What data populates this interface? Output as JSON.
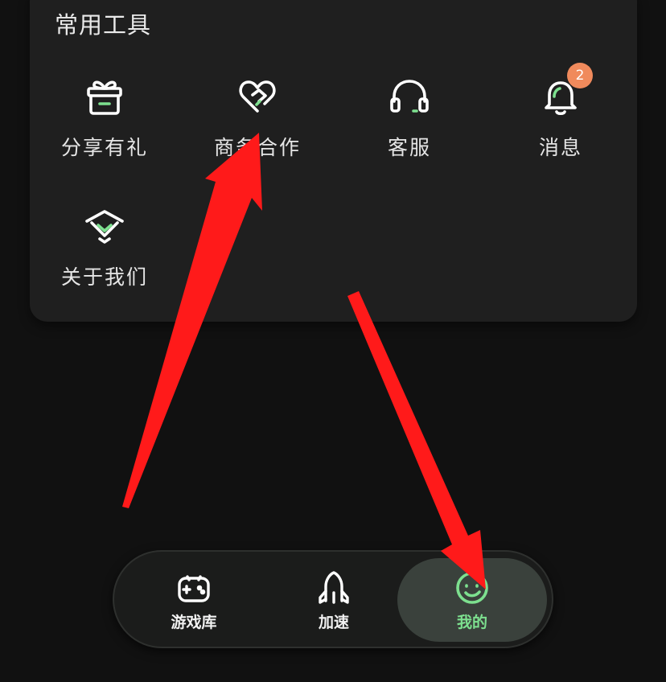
{
  "section": {
    "title": "常用工具"
  },
  "tools": [
    {
      "label": "分享有礼",
      "icon": "gift-icon"
    },
    {
      "label": "商务合作",
      "icon": "heart-handshake-icon"
    },
    {
      "label": "客服",
      "icon": "headset-icon"
    },
    {
      "label": "消息",
      "icon": "bell-icon",
      "badge": "2"
    },
    {
      "label": "关于我们",
      "icon": "about-logo-icon"
    }
  ],
  "tabbar": {
    "items": [
      {
        "label": "游戏库",
        "icon": "gamepad-icon",
        "active": false
      },
      {
        "label": "加速",
        "icon": "rocket-icon",
        "active": false
      },
      {
        "label": "我的",
        "icon": "smiley-icon",
        "active": true
      }
    ]
  },
  "colors": {
    "accent": "#7de08f",
    "badge": "#f08a5c",
    "annotation_arrow": "#ff1a1a"
  }
}
